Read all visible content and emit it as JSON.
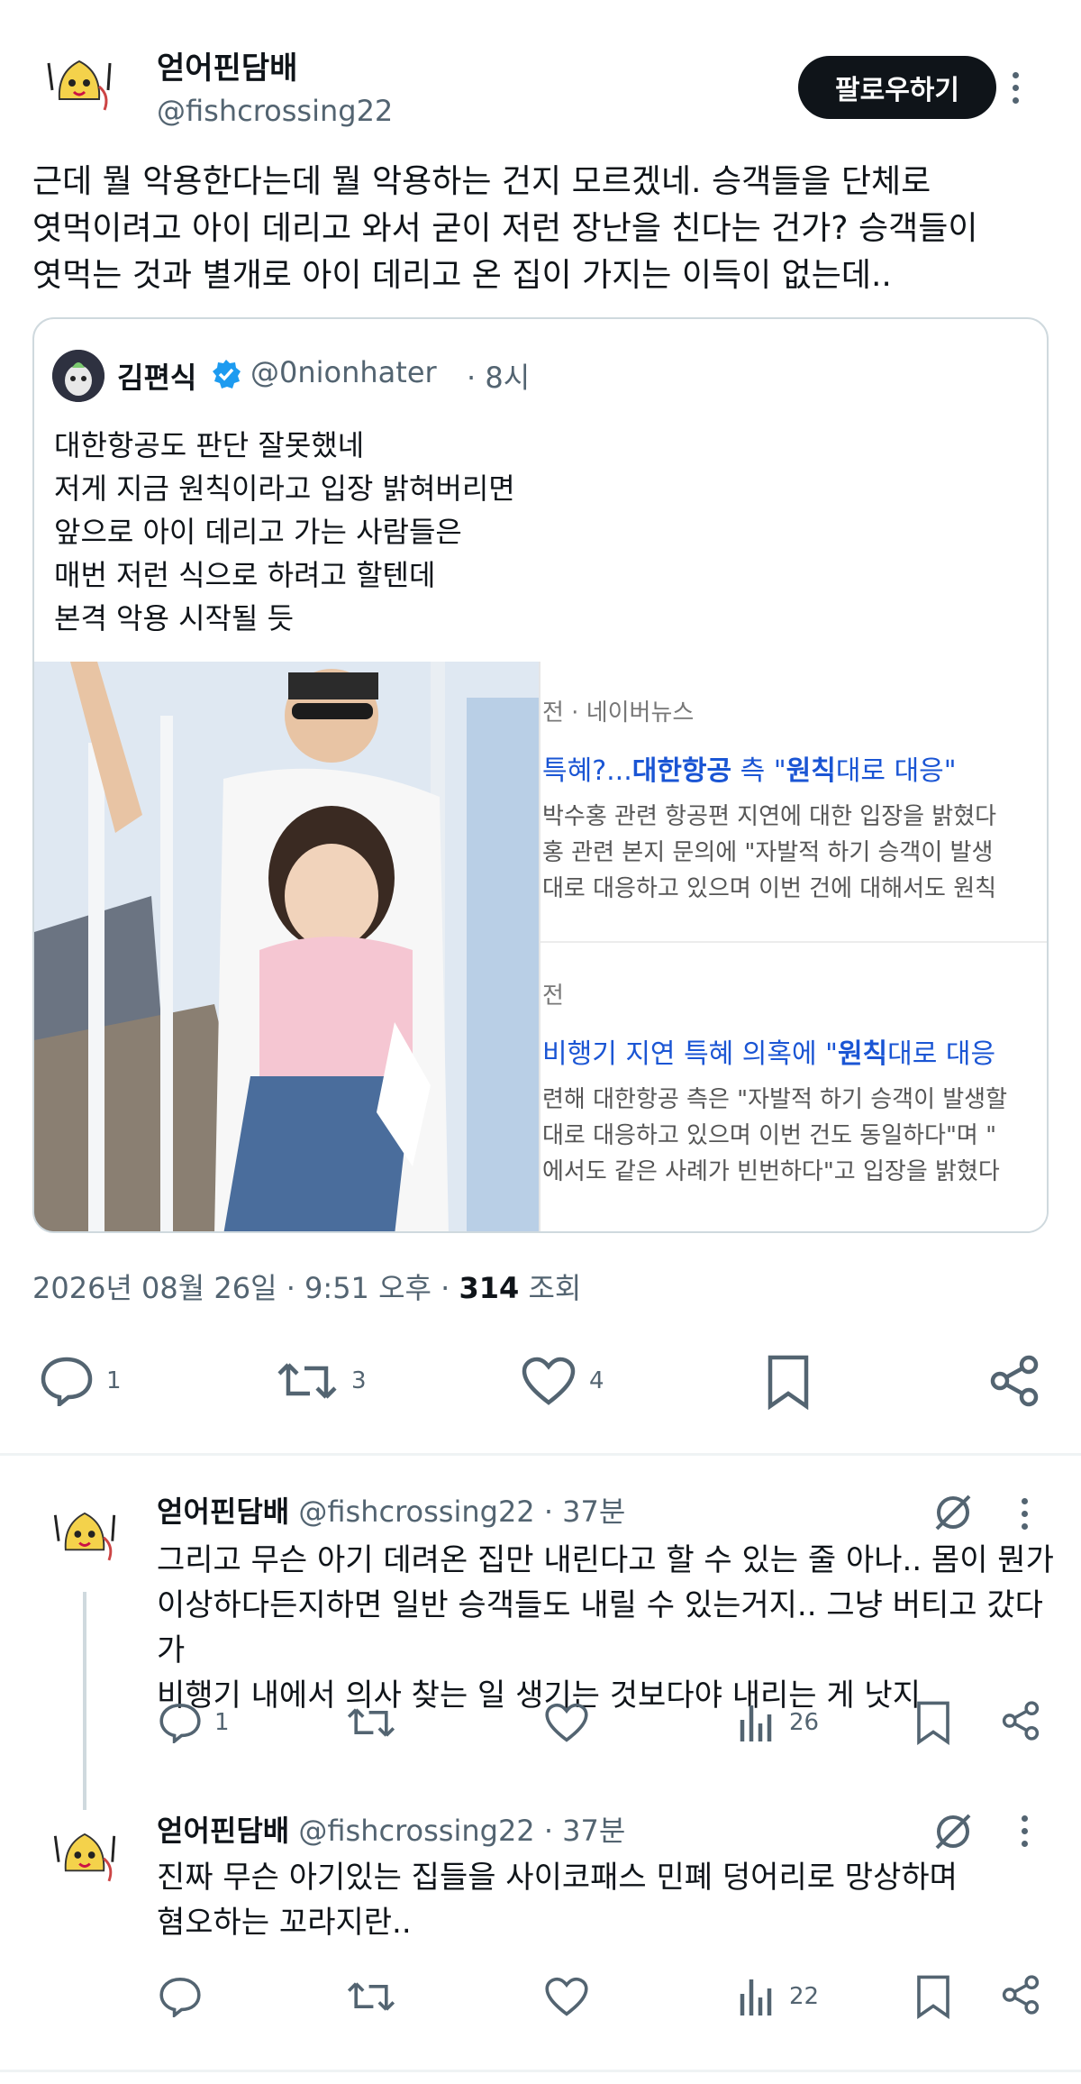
{
  "main_tweet": {
    "display_name": "얻어핀담배",
    "handle": "@fishcrossing22",
    "follow_label": "팔로우하기",
    "text": "근데 뭘 악용한다는데 뭘 악용하는 건지 모르겠네. 승객들을 단체로\n엿먹이려고 아이 데리고 와서 굳이 저런 장난을 친다는 건가? 승객들이\n엿먹는 것과 별개로 아이 데리고 온 집이 가지는 이득이 없는데..",
    "timestamp": "2026년 08월 26일 · 9:51 오후",
    "views_count": "314",
    "views_label": "조회",
    "replies": "1",
    "retweets": "3",
    "likes": "4"
  },
  "quoted_tweet": {
    "display_name": "김편식",
    "handle": "@0nionhater",
    "time": "· 8시",
    "text": "대한항공도 판단 잘못했네\n저게 지금 원칙이라고 입장 밝혀버리면\n앞으로 아이 데리고 가는 사람들은\n매번 저런 식으로 하려고 할텐데\n본격 악용 시작될 듯"
  },
  "news_cards": [
    {
      "source": "전 · 네이버뉴스",
      "title_prefix": "특혜?...",
      "title_bold1": "대한항공",
      "title_mid": " 측 \"",
      "title_bold2": "원칙",
      "title_suffix": "대로 대응\"",
      "body": "박수홍 관련 항공편 지연에 대한 입장을 밝혔다\n홍 관련 본지 문의에 \"자발적 하기 승객이 발생\n대로 대응하고 있으며 이번 건에 대해서도 원칙"
    },
    {
      "source": "전",
      "title_prefix": "비행기 지연 특혜 의혹에 \"",
      "title_bold1": "원칙",
      "title_mid": "대로 대응",
      "title_bold2": "",
      "title_suffix": "",
      "body": "련해 대한항공 측은 \"자발적 하기 승객이 발생할\n대로 대응하고 있으며 이번 건도 동일하다\"며 \"\n에서도 같은 사례가 빈번하다\"고 입장을 밝혔다"
    }
  ],
  "replies": [
    {
      "display_name": "얻어핀담배",
      "handle": "@fishcrossing22",
      "time": "· 37분",
      "text": "그리고 무슨 아기 데려온 집만 내린다고 할 수 있는 줄 아나.. 몸이 뭔가\n이상하다든지하면 일반 승객들도 내릴 수 있는거지.. 그냥 버티고 갔다가\n비행기 내에서 의사 찾는 일 생기는 것보다야 내리는 게 낫지",
      "replies": "1",
      "views": "26"
    },
    {
      "display_name": "얻어핀담배",
      "handle": "@fishcrossing22",
      "time": "· 37분",
      "text": "진짜 무슨 아기있는 집들을 사이코패스 민폐 덩어리로 망상하며\n혐오하는 꼬라지란..",
      "replies": "",
      "views": "22"
    }
  ],
  "icons": {
    "reply": "reply-icon",
    "retweet": "retweet-icon",
    "like": "heart-icon",
    "bookmark": "bookmark-icon",
    "share": "share-icon",
    "views": "views-icon",
    "grok": "grok-icon",
    "verified": "verified-badge-icon"
  },
  "colors": {
    "text": "#0f1419",
    "muted": "#536471",
    "verified": "#1d9bf0",
    "link_blue": "#1a55d4"
  }
}
